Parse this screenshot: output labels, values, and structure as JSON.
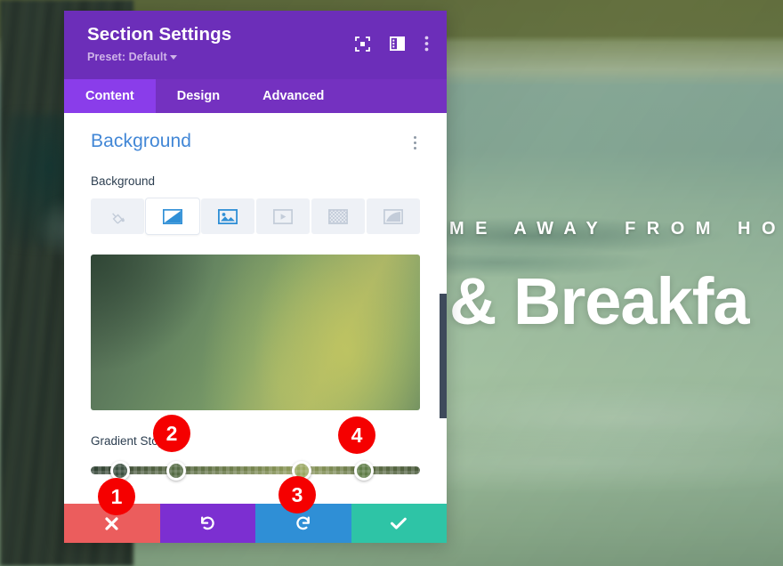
{
  "panel": {
    "title": "Section Settings",
    "preset_label": "Preset: Default",
    "header_icons": [
      {
        "name": "focus-frame-icon",
        "glyph": "focus"
      },
      {
        "name": "layout-panel-icon",
        "glyph": "layout"
      },
      {
        "name": "more-options-icon",
        "glyph": "kebab"
      }
    ],
    "tabs": [
      {
        "label": "Content",
        "active": true
      },
      {
        "label": "Design",
        "active": false
      },
      {
        "label": "Advanced",
        "active": false
      }
    ]
  },
  "background_section": {
    "section_title": "Background",
    "section_menu_icon": "kebab-icon",
    "field_label": "Background",
    "type_tabs": [
      {
        "name": "background-color",
        "icon": "paint-bucket-icon",
        "active": false,
        "color": "#c3ccd9"
      },
      {
        "name": "background-gradient",
        "icon": "gradient-icon",
        "active": true,
        "color": "#2f8fd6"
      },
      {
        "name": "background-image",
        "icon": "image-icon",
        "active": false,
        "color": "#2f8fd6"
      },
      {
        "name": "background-video",
        "icon": "video-icon",
        "active": false,
        "color": "#c3ccd9"
      },
      {
        "name": "background-pattern",
        "icon": "pattern-icon",
        "active": false,
        "color": "#c3ccd9"
      },
      {
        "name": "background-mask",
        "icon": "mask-icon",
        "active": false,
        "color": "#c3ccd9"
      }
    ],
    "gradient_preview_name": "gradient-preview",
    "gradient_stops_label": "Gradient Stops",
    "gradient_stops": [
      {
        "index": 1,
        "position_pct": 9,
        "color": "#3c5040"
      },
      {
        "index": 2,
        "position_pct": 26,
        "color": "#566c45"
      },
      {
        "index": 3,
        "position_pct": 64,
        "color": "#9aa862"
      },
      {
        "index": 4,
        "position_pct": 83,
        "color": "#5f7d47"
      }
    ]
  },
  "footer": {
    "buttons": [
      {
        "name": "cancel-button",
        "icon": "close-x-icon",
        "color": "#eb5d5d"
      },
      {
        "name": "undo-button",
        "icon": "undo-arrow-icon",
        "color": "#7c2fd1"
      },
      {
        "name": "redo-button",
        "icon": "redo-arrow-icon",
        "color": "#2f8fd6"
      },
      {
        "name": "save-button",
        "icon": "checkmark-icon",
        "color": "#2ec4a6"
      }
    ]
  },
  "annotation_badges": [
    {
      "label": "1"
    },
    {
      "label": "2"
    },
    {
      "label": "3"
    },
    {
      "label": "4"
    }
  ],
  "website_background": {
    "eyebrow_text": "ME AWAY FROM HOME",
    "headline_text": "& Breakfa"
  }
}
